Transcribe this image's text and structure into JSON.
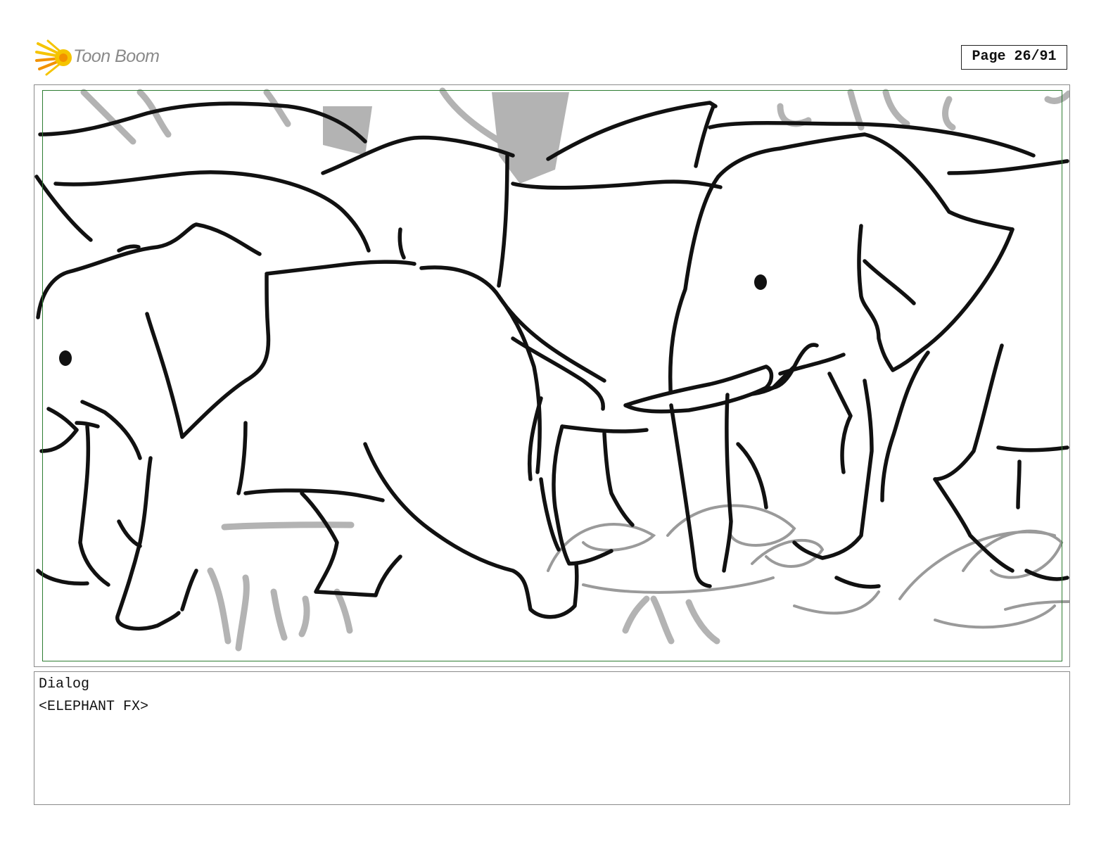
{
  "header": {
    "logo_text": "Toon Boom",
    "logo_icon": "starburst-icon",
    "page_label": "Page 26/91"
  },
  "panel": {
    "image_subject": "elephant-herd-sketch",
    "safe_frame_color": "#2e7d32"
  },
  "dialog": {
    "label": "Dialog",
    "text": "<ELEPHANT FX>"
  },
  "colors": {
    "logo_yellow": "#f5c400",
    "logo_orange": "#f29200",
    "logo_text": "#8a8a8a",
    "line_dark": "#111111",
    "line_grey": "#9a9a9a"
  }
}
